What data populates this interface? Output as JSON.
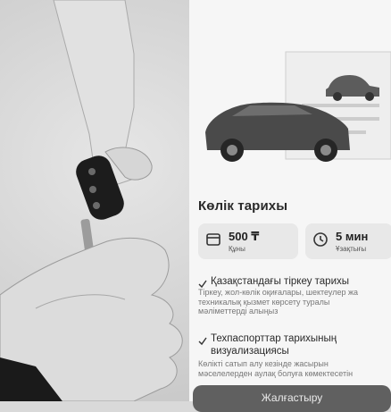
{
  "section": {
    "title": "Көлік тарихы"
  },
  "price": {
    "value": "500 ₸",
    "caption": "Құны"
  },
  "duration": {
    "value": "5 мин",
    "caption": "Ұзақтығы"
  },
  "features": [
    {
      "title": "Қазақстандағы тіркеу тарихы",
      "desc_lines": [
        "Тіркеу, жол-көлік оқиғалары, шектеулер жа",
        "техникалық қызмет көрсету туралы",
        "мәліметтерді алыңыз"
      ]
    },
    {
      "title_lines": [
        "Техпаспорттар тарихының",
        "визуализациясы"
      ],
      "desc_lines": [
        "Көлікті сатып алу кезінде жасырын",
        "мәселелерден аулақ болуға көмектесетін"
      ]
    }
  ],
  "cta": {
    "label": "Жалғастыру"
  },
  "icons": {
    "price": "card-icon",
    "duration": "clock-icon",
    "check": "check-icon",
    "car": "car-icon"
  }
}
